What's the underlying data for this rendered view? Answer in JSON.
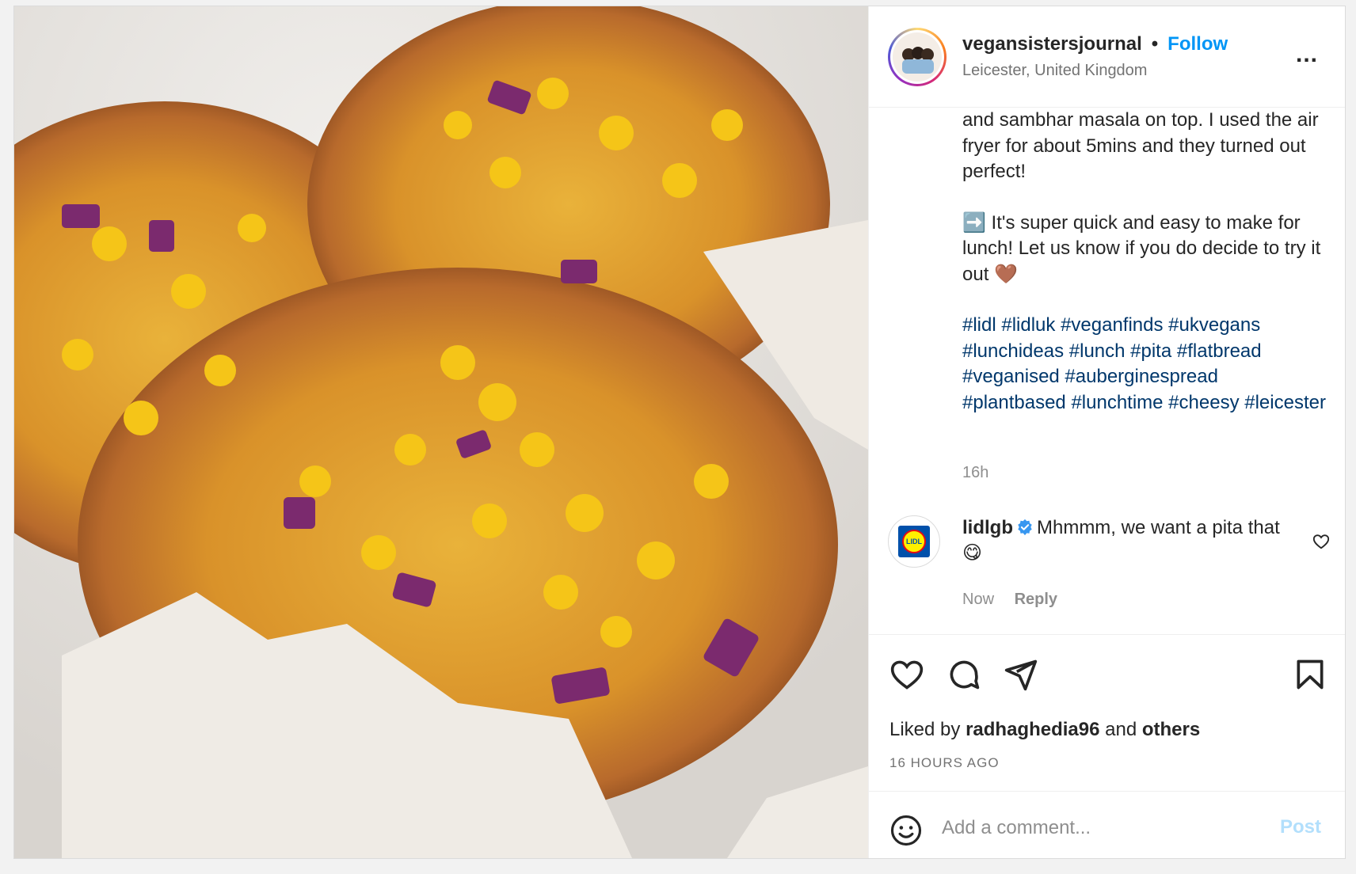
{
  "header": {
    "username": "vegansistersjournal",
    "separator": "•",
    "follow_label": "Follow",
    "location": "Leicester, United Kingdom",
    "more_label": "..."
  },
  "caption": {
    "line1": "and sambhar masala on top. I used the air fryer for about 5mins and they turned out perfect!",
    "line2": "➡️ It's super quick and easy to make for lunch! Let us know if you do decide to try it out 🤎",
    "hashtags": "#lidl #lidluk #veganfinds #ukvegans #lunchideas #lunch #pita #flatbread #veganised #auberginespread #plantbased #lunchtime #cheesy #leicester",
    "time": "16h"
  },
  "comment": {
    "username": "lidlgb",
    "text": "Mhmmm, we want a pita that 😋",
    "time": "Now",
    "reply_label": "Reply",
    "avatar_text": "LIDL"
  },
  "actions": {
    "liked_by_prefix": "Liked by ",
    "liked_by_user": "radhaghedia96",
    "liked_by_mid": " and ",
    "liked_by_others": "others",
    "time_ago": "16 HOURS AGO"
  },
  "add_comment": {
    "placeholder": "Add a comment...",
    "post_label": "Post"
  },
  "colors": {
    "link_blue": "#0095f6",
    "hashtag": "#00376b",
    "post_disabled": "#b2dffc",
    "secondary_text": "#8e8e8e"
  },
  "icons": [
    "heart-icon",
    "comment-icon",
    "share-icon",
    "bookmark-icon",
    "emoji-icon",
    "verified-icon",
    "more-icon"
  ]
}
